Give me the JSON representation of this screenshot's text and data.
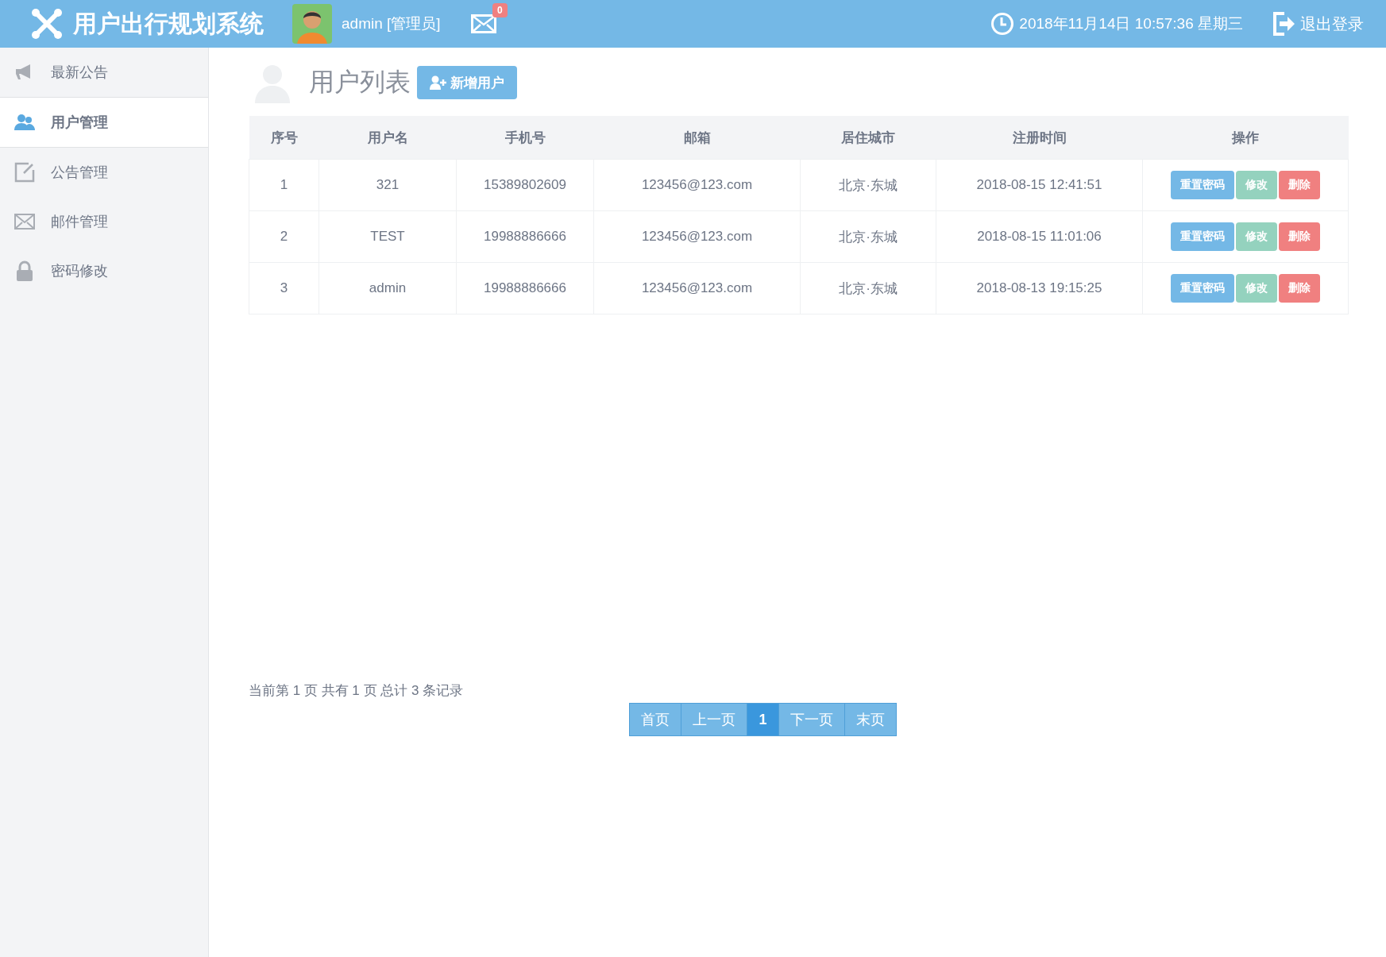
{
  "header": {
    "title": "用户出行规划系统",
    "user": "admin [管理员]",
    "mail_count": "0",
    "datetime": "2018年11月14日 10:57:36 星期三",
    "logout": "退出登录"
  },
  "sidebar": {
    "items": [
      {
        "label": "最新公告",
        "kind": "megaphone",
        "selected": false
      },
      {
        "label": "用户管理",
        "kind": "users",
        "selected": true
      },
      {
        "label": "公告管理",
        "kind": "edit",
        "selected": false
      },
      {
        "label": "邮件管理",
        "kind": "mail",
        "selected": false
      },
      {
        "label": "密码修改",
        "kind": "lock",
        "selected": false
      }
    ]
  },
  "page": {
    "title": "用户列表",
    "add_button": "新增用户"
  },
  "table": {
    "columns": [
      "序号",
      "用户名",
      "手机号",
      "邮箱",
      "居住城市",
      "注册时间",
      "操作"
    ],
    "rows": [
      {
        "cells": [
          "1",
          "321",
          "15389802609",
          "123456@123.com",
          "北京·东城",
          "2018-08-15 12:41:51"
        ],
        "actions": [
          {
            "label": "重置密码",
            "kind": "reset"
          },
          {
            "label": "修改",
            "kind": "edit"
          },
          {
            "label": "删除",
            "kind": "delete"
          }
        ]
      },
      {
        "cells": [
          "2",
          "TEST",
          "19988886666",
          "123456@123.com",
          "北京·东城",
          "2018-08-15 11:01:06"
        ],
        "actions": [
          {
            "label": "重置密码",
            "kind": "reset"
          },
          {
            "label": "修改",
            "kind": "edit"
          },
          {
            "label": "删除",
            "kind": "delete"
          }
        ]
      },
      {
        "cells": [
          "3",
          "admin",
          "19988886666",
          "123456@123.com",
          "北京·东城",
          "2018-08-13 19:15:25"
        ],
        "actions": [
          {
            "label": "重置密码",
            "kind": "reset"
          },
          {
            "label": "修改",
            "kind": "edit"
          },
          {
            "label": "删除",
            "kind": "delete"
          }
        ]
      }
    ]
  },
  "pagination": {
    "info": "当前第 1 页 共有 1 页 总计 3 条记录",
    "buttons": [
      {
        "label": "首页",
        "selected": false
      },
      {
        "label": "上一页",
        "selected": false
      },
      {
        "label": "1",
        "selected": true
      },
      {
        "label": "下一页",
        "selected": false
      },
      {
        "label": "末页",
        "selected": false
      }
    ]
  }
}
